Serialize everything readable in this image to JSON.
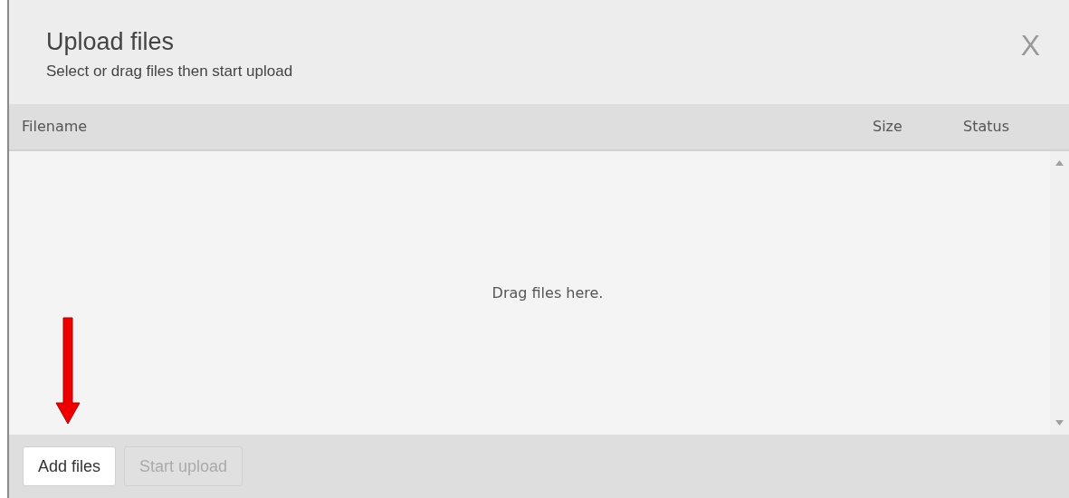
{
  "dialog": {
    "title": "Upload files",
    "subtitle": "Select or drag files then start upload",
    "close": "X"
  },
  "table": {
    "columns": [
      "Filename",
      "Size",
      "Status"
    ],
    "empty_text": "Drag files here."
  },
  "buttons": [
    {
      "label": "Add files",
      "disabled": false
    },
    {
      "label": "Start upload",
      "disabled": true
    }
  ]
}
